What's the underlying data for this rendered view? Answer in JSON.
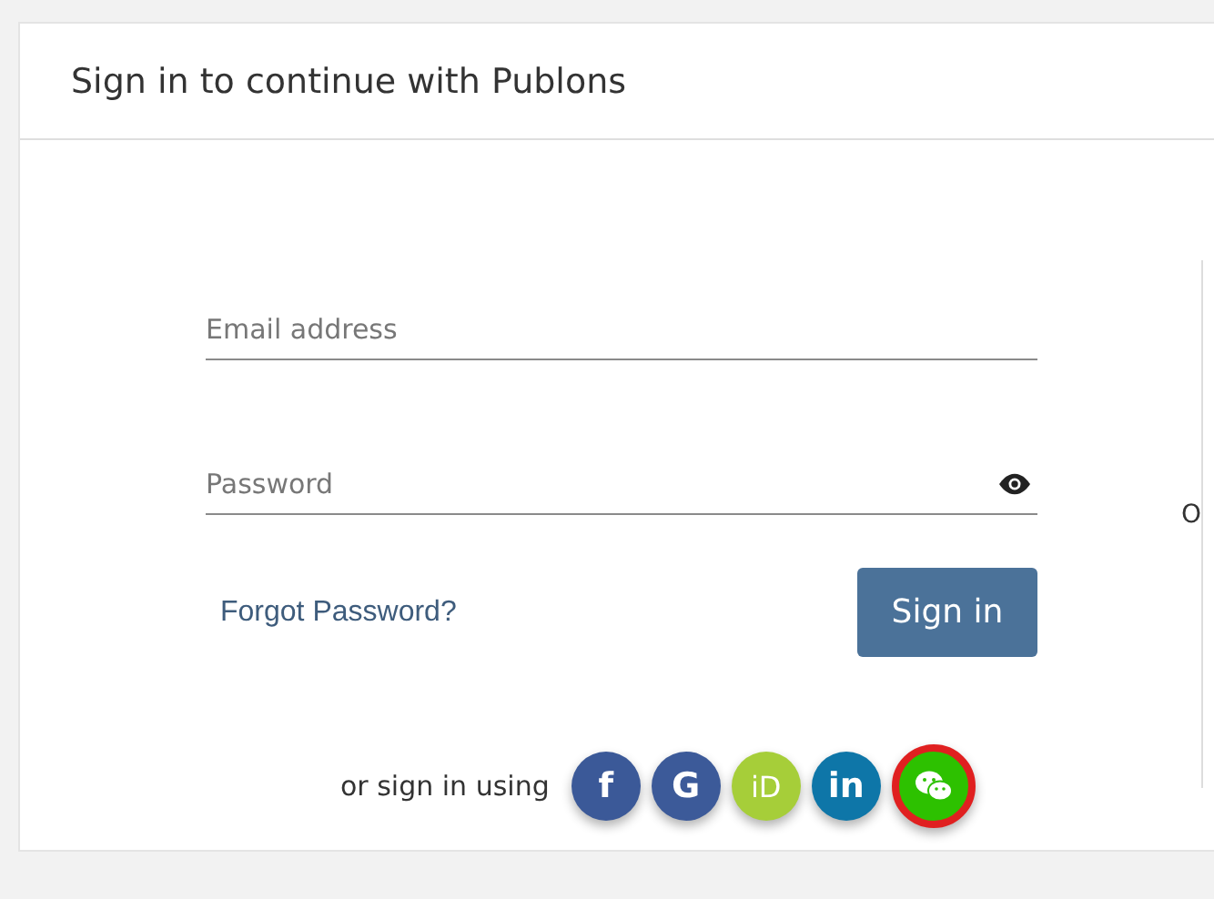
{
  "header": {
    "title": "Sign in to continue with Publons"
  },
  "fields": [
    {
      "kind": "email",
      "placeholder": "Email address"
    },
    {
      "kind": "password",
      "placeholder": "Password"
    }
  ],
  "forgot_link": "Forgot Password?",
  "sign_in_button": "Sign in",
  "social": {
    "label": "or sign in using",
    "providers": [
      {
        "kind": "facebook",
        "label": "f",
        "color": "#3b5998",
        "highlighted": false
      },
      {
        "kind": "google",
        "label": "G",
        "color": "#3c5a99",
        "highlighted": false
      },
      {
        "kind": "orcid",
        "label": "iD",
        "color": "#a6ce39",
        "highlighted": false
      },
      {
        "kind": "linkedin",
        "label": "in",
        "color": "#0e76a8",
        "highlighted": false
      },
      {
        "kind": "wechat",
        "color": "#2dc100",
        "highlighted": true
      }
    ]
  },
  "divider_label": "O"
}
